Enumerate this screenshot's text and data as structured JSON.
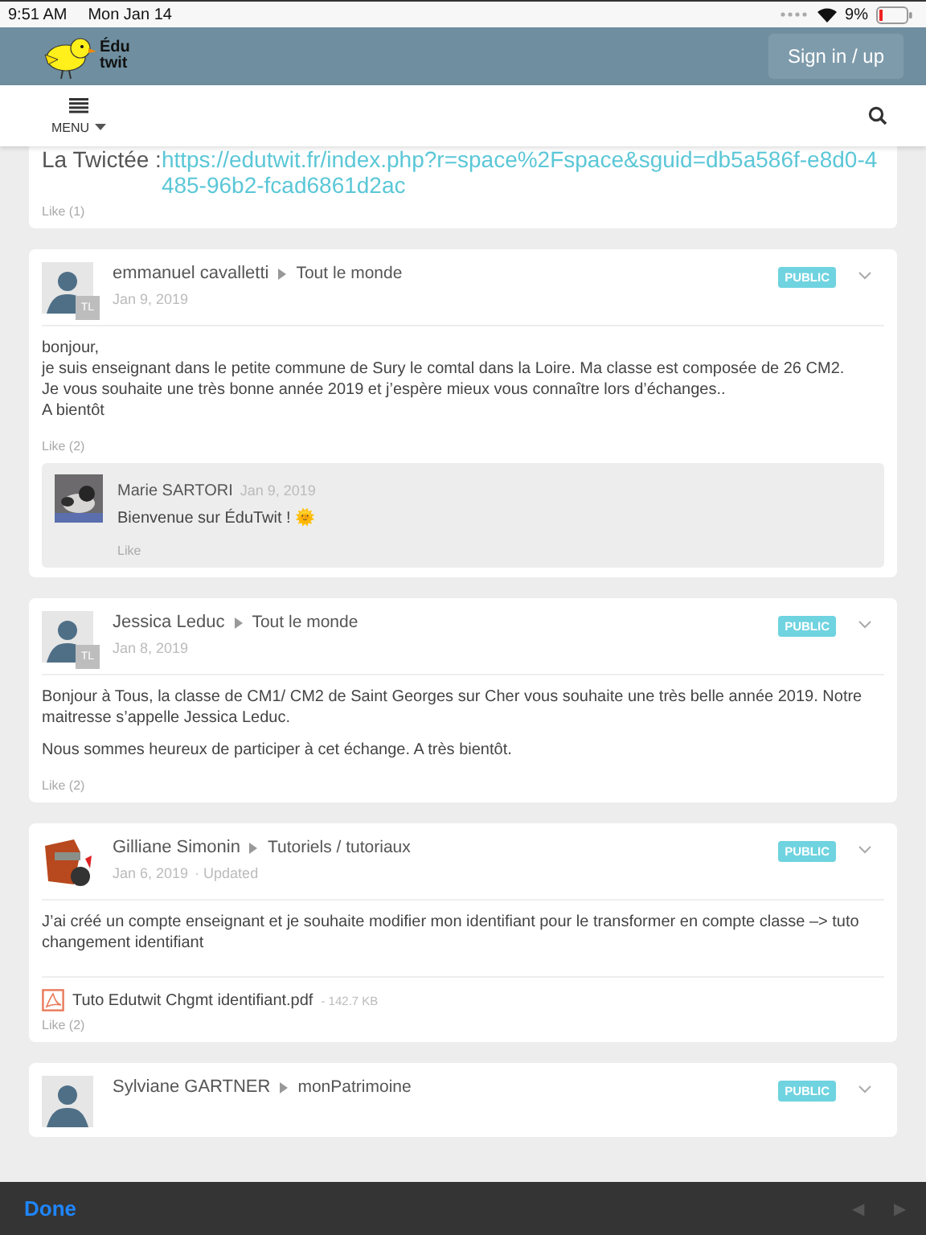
{
  "status_bar": {
    "time": "9:51 AM",
    "date": "Mon Jan 14",
    "battery": "9%"
  },
  "header": {
    "logo_top": "Édu",
    "logo_bottom": "twit",
    "sign_in": "Sign in / up"
  },
  "nav": {
    "menu": "MENU"
  },
  "feed": [
    {
      "kind": "link",
      "title": "La Twictée : ",
      "link": "https://edutwit.fr/index.php?r=space%2Fspace&sguid=db5a586f-e8d0-4485-96b2-fcad6861d2ac",
      "like": "Like (1)"
    },
    {
      "kind": "post",
      "avatar": {
        "kind": "silhouette"
      },
      "avatar_badge": "TL",
      "author": "emmanuel cavalletti",
      "space": "Tout le monde",
      "date": "Jan 9, 2019",
      "visibility": "PUBLIC",
      "paragraphs": [
        [
          "bonjour,",
          "je suis enseignant dans le petite commune de Sury le comtal dans la Loire. Ma classe est composée de 26 CM2.",
          "Je vous souhaite une très bonne année 2019 et j’espère mieux vous connaître lors d’échanges..",
          "A bientôt"
        ]
      ],
      "like": "Like (2)",
      "comments": [
        {
          "author": "Marie SARTORI",
          "date": "Jan 9, 2019",
          "text": "Bienvenue sur ÉduTwit ! ",
          "emoji": "🌞",
          "like": "Like"
        }
      ]
    },
    {
      "kind": "post",
      "avatar": {
        "kind": "silhouette"
      },
      "avatar_badge": "TL",
      "author": "Jessica Leduc",
      "space": "Tout le monde",
      "date": "Jan 8, 2019",
      "visibility": "PUBLIC",
      "paragraphs": [
        [
          "Bonjour à Tous, la classe de CM1/ CM2 de Saint Georges sur Cher vous souhaite une très belle année 2019. Notre maitresse s’appelle Jessica Leduc."
        ],
        [
          "Nous sommes heureux de participer à cet échange. A très bientôt."
        ]
      ],
      "like": "Like (2)"
    },
    {
      "kind": "post",
      "avatar": {
        "kind": "picture"
      },
      "author": "Gilliane Simonin",
      "space": "Tutoriels / tutoriaux",
      "date": "Jan 6, 2019",
      "updated": "· Updated",
      "visibility": "PUBLIC",
      "paragraphs": [
        [
          "J’ai créé un compte enseignant et je souhaite modifier mon identifiant pour le transformer en compte classe –> tuto changement identifiant"
        ]
      ],
      "attachment": {
        "name": "Tuto Edutwit Chgmt identifiant.pdf",
        "size": "- 142.7 KB"
      },
      "like": "Like (2)"
    },
    {
      "kind": "post",
      "avatar": {
        "kind": "silhouette"
      },
      "author": "Sylviane GARTNER",
      "space": "monPatrimoine",
      "visibility": "PUBLIC"
    }
  ],
  "toolbar": {
    "done": "Done",
    "nav_buttons": [
      {
        "label": "◀",
        "disabled": true
      },
      {
        "label": "▶",
        "disabled": true
      }
    ]
  }
}
